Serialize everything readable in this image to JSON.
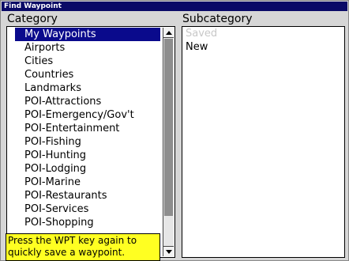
{
  "window": {
    "title": "Find Waypoint"
  },
  "category": {
    "header": "Category",
    "items": [
      {
        "label": "My Waypoints",
        "selected": true
      },
      {
        "label": "Airports"
      },
      {
        "label": "Cities"
      },
      {
        "label": "Countries"
      },
      {
        "label": "Landmarks"
      },
      {
        "label": "POI-Attractions"
      },
      {
        "label": "POI-Emergency/Gov't"
      },
      {
        "label": "POI-Entertainment"
      },
      {
        "label": "POI-Fishing"
      },
      {
        "label": "POI-Hunting"
      },
      {
        "label": "POI-Lodging"
      },
      {
        "label": "POI-Marine"
      },
      {
        "label": "POI-Restaurants"
      },
      {
        "label": "POI-Services"
      },
      {
        "label": "POI-Shopping"
      }
    ]
  },
  "subcategory": {
    "header": "Subcategory",
    "items": [
      {
        "label": "Saved",
        "disabled": true
      },
      {
        "label": "New"
      }
    ]
  },
  "tooltip": {
    "line1": "Press the WPT key again to",
    "line2": "quickly save a waypoint."
  },
  "icons": {
    "scroll_up": "arrow-up-icon",
    "scroll_down": "arrow-down-icon"
  }
}
